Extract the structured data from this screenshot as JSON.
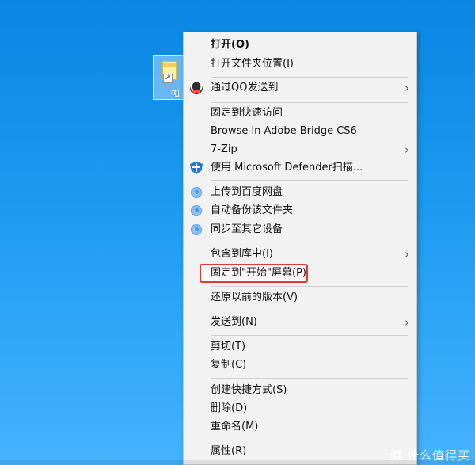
{
  "desktop": {
    "selected_icon": {
      "label_visible": "帕"
    }
  },
  "context_menu": {
    "items": [
      {
        "label": "打开(O)"
      },
      {
        "label": "打开文件夹位置(I)"
      },
      {
        "label": "通过QQ发送到"
      },
      {
        "label": "固定到快速访问"
      },
      {
        "label": "Browse in Adobe Bridge CS6"
      },
      {
        "label": "7-Zip"
      },
      {
        "label": "使用 Microsoft Defender扫描..."
      },
      {
        "label": "上传到百度网盘"
      },
      {
        "label": "自动备份该文件夹"
      },
      {
        "label": "同步至其它设备"
      },
      {
        "label": "包含到库中(I)"
      },
      {
        "label": "固定到\"开始\"屏幕(P)"
      },
      {
        "label": "还原以前的版本(V)"
      },
      {
        "label": "发送到(N)"
      },
      {
        "label": "剪切(T)"
      },
      {
        "label": "复制(C)"
      },
      {
        "label": "创建快捷方式(S)"
      },
      {
        "label": "删除(D)"
      },
      {
        "label": "重命名(M)"
      },
      {
        "label": "属性(R)"
      }
    ]
  },
  "watermark": {
    "text": "值 什么值得买"
  },
  "colors": {
    "desktop_blue": "#1d9bf0",
    "menu_background": "#f2f2f2",
    "highlight_red": "#df3b32",
    "defender_blue": "#1f79d0",
    "baidu_blue": "#4f94e2"
  }
}
